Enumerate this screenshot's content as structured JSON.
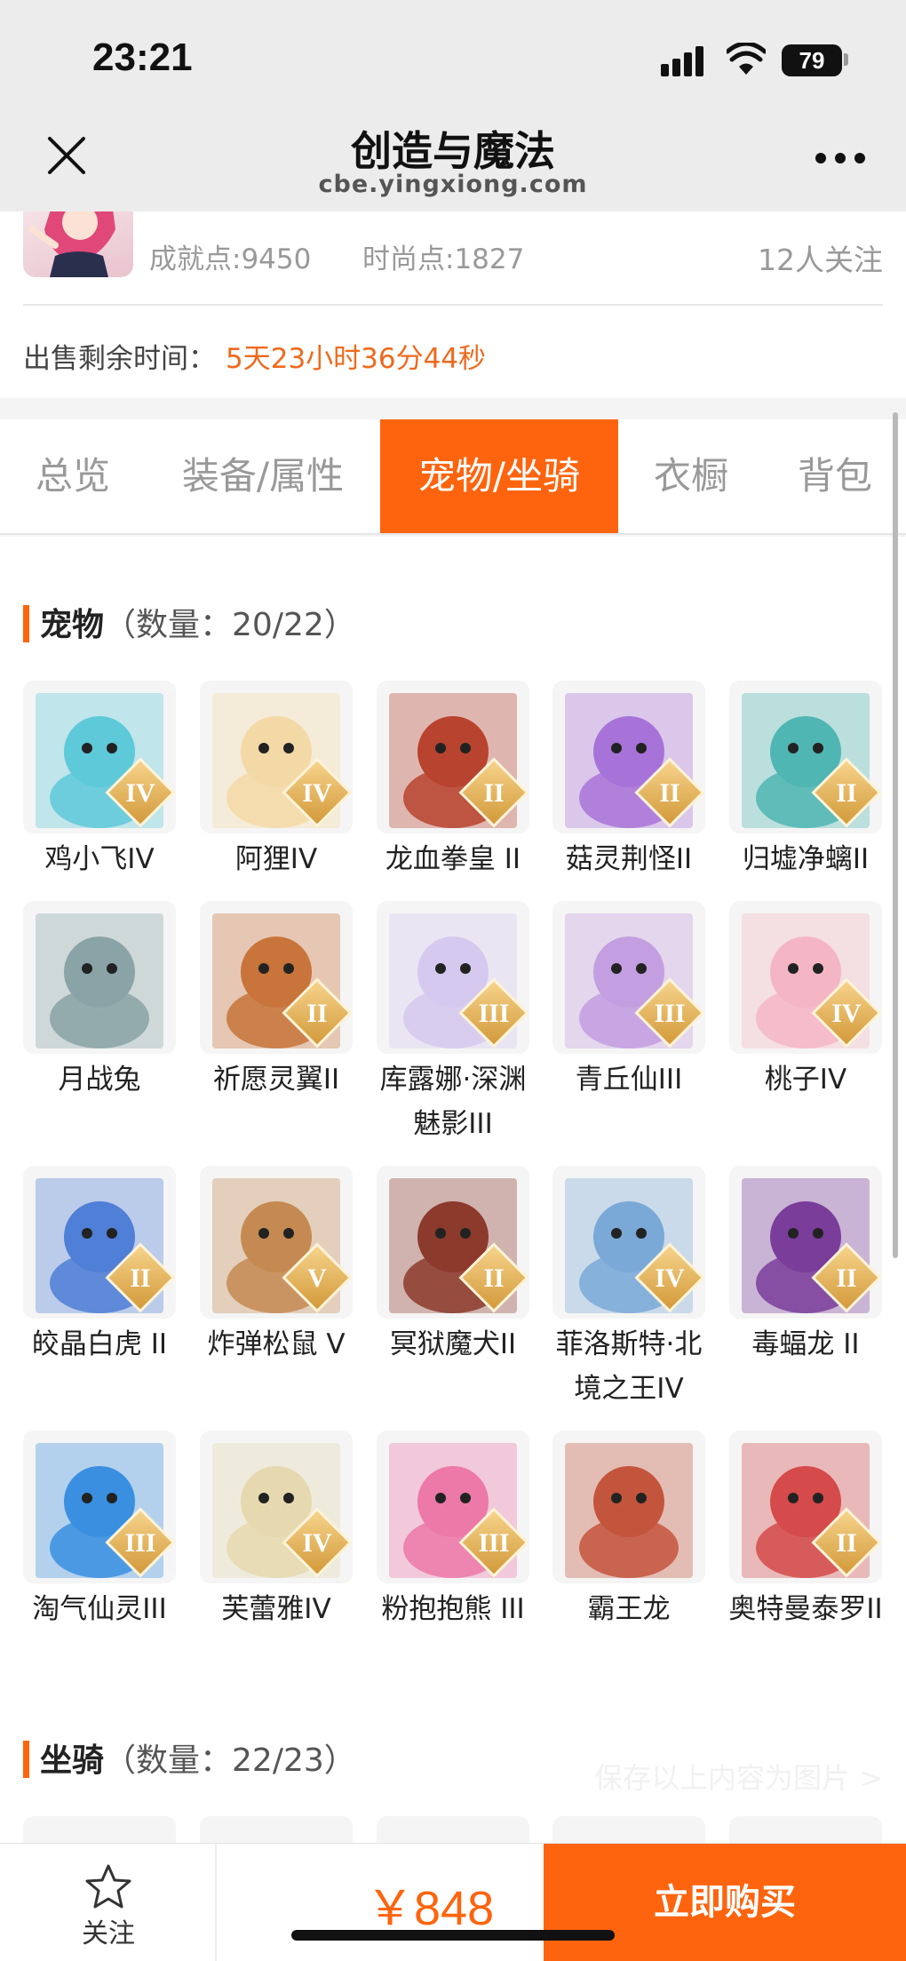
{
  "status_bar": {
    "time": "23:21",
    "battery": "79"
  },
  "header": {
    "title": "创造与魔法",
    "subtitle": "cbe.yingxiong.com"
  },
  "profile": {
    "achievement": "成就点:9450",
    "fashion": "时尚点:1827",
    "followers": "12人关注",
    "sale_label": "出售剩余时间：",
    "sale_time": "5天23小时36分44秒"
  },
  "tabs": [
    {
      "label": "总览"
    },
    {
      "label": "装备/属性"
    },
    {
      "label": "宠物/坐骑",
      "active": true
    },
    {
      "label": "衣橱"
    },
    {
      "label": "背包"
    }
  ],
  "pets_section": {
    "title": "宠物",
    "count": "（数量：20/22）"
  },
  "pets": [
    {
      "name": "鸡小飞IV",
      "badge": "IV",
      "color": "#5ec9d9"
    },
    {
      "name": "阿狸IV",
      "badge": "IV",
      "color": "#f3d9a6"
    },
    {
      "name": "龙血拳皇 II",
      "badge": "II",
      "color": "#b8432f"
    },
    {
      "name": "菇灵荆怪II",
      "badge": "II",
      "color": "#a873d8"
    },
    {
      "name": "归墟净螭II",
      "badge": "II",
      "color": "#4fb6b3"
    },
    {
      "name": "月战兔",
      "badge": "",
      "color": "#8aa3a6"
    },
    {
      "name": "祈愿灵翼II",
      "badge": "II",
      "color": "#c8743a"
    },
    {
      "name": "库露娜·深渊魅影III",
      "badge": "III",
      "color": "#d6c9ef"
    },
    {
      "name": "青丘仙III",
      "badge": "III",
      "color": "#c39ee0"
    },
    {
      "name": "桃子IV",
      "badge": "IV",
      "color": "#f4b6c4"
    },
    {
      "name": "皎晶白虎 II",
      "badge": "II",
      "color": "#4f7fd6"
    },
    {
      "name": "炸弹松鼠 V",
      "badge": "V",
      "color": "#c58a52"
    },
    {
      "name": "冥狱魔犬II",
      "badge": "II",
      "color": "#8c3a2c"
    },
    {
      "name": "菲洛斯特·北境之王IV",
      "badge": "IV",
      "color": "#7aa9d8"
    },
    {
      "name": "毒蝠龙 II",
      "badge": "II",
      "color": "#7a3d9a"
    },
    {
      "name": "淘气仙灵III",
      "badge": "III",
      "color": "#3a8fe0"
    },
    {
      "name": "芙蕾雅IV",
      "badge": "IV",
      "color": "#e6d9b0"
    },
    {
      "name": "粉抱抱熊 III",
      "badge": "III",
      "color": "#ec79a8"
    },
    {
      "name": "霸王龙",
      "badge": "",
      "color": "#c4553d"
    },
    {
      "name": "奥特曼泰罗II",
      "badge": "II",
      "color": "#d54a4a"
    }
  ],
  "mounts_section": {
    "title": "坐骑",
    "count": "（数量：22/23）"
  },
  "save_hint": "保存以上内容为图片 >",
  "bottom": {
    "follow_label": "关注",
    "price": "￥848",
    "buy_label": "立即购买"
  }
}
